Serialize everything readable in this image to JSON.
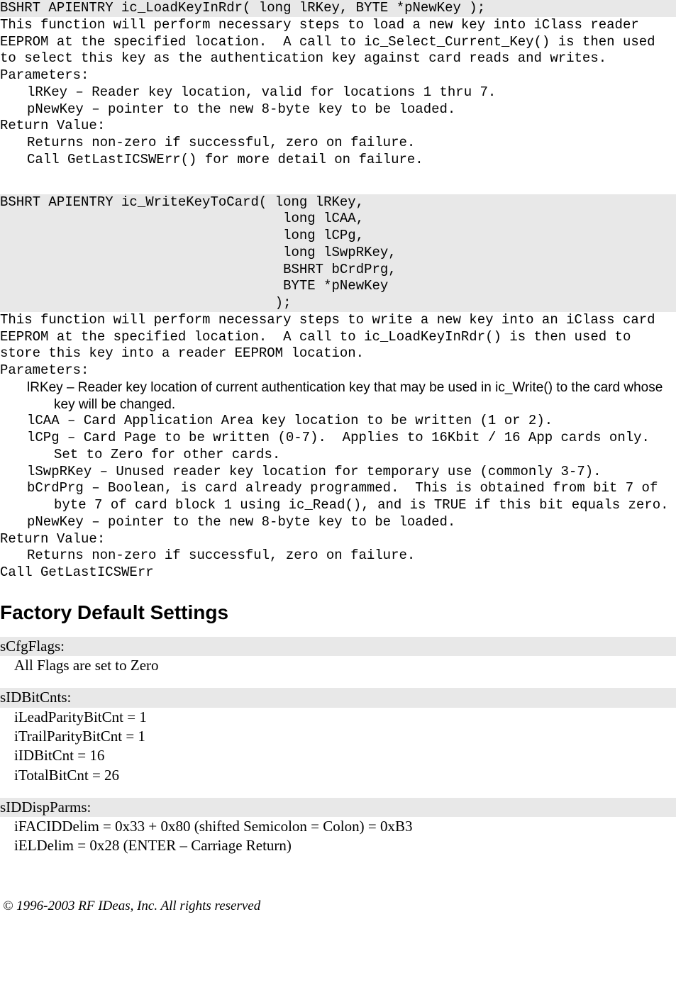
{
  "func1": {
    "sig": "BSHRT APIENTRY ic_LoadKeyInRdr( long lRKey, BYTE *pNewKey );",
    "desc": "This function will perform necessary steps to load a new key into iClass reader EEPROM at the specified location.  A call to ic_Select_Current_Key() is then used to select this key as the authentication key against card reads and writes.",
    "params_label": "Parameters:",
    "p1": "lRKey – Reader key location, valid for locations 1 thru 7.",
    "p2": "pNewKey – pointer to the new 8-byte key to be loaded.",
    "ret_label": "Return Value:",
    "r1": "Returns non-zero if successful, zero on failure.",
    "r2": "Call GetLastICSWErr() for more detail on failure."
  },
  "func2": {
    "sig": "BSHRT APIENTRY ic_WriteKeyToCard( long lRKey,\n                                   long lCAA,\n                                   long lCPg,\n                                   long lSwpRKey,\n                                   BSHRT bCrdPrg,\n                                   BYTE *pNewKey\n                                  );",
    "desc": "This function will perform necessary steps to write a new key into an iClass card EEPROM at the specified location.  A call to ic_LoadKeyInRdr() is then used to store this key into a reader EEPROM location.",
    "params_label": "Parameters:",
    "p1": "lRKey – Reader key location of current authentication key that may be used in ic_Write() to the card whose key will be changed.",
    "p2": "lCAA – Card Application Area key location to be written (1 or 2).",
    "p3": "lCPg – Card Page to be written (0-7).  Applies to 16Kbit / 16 App cards only.  Set to Zero for other cards.",
    "p4": "lSwpRKey – Unused reader key location for temporary use (commonly 3-7).",
    "p5": "bCrdPrg – Boolean, is card already programmed.  This is obtained from bit 7 of byte 7 of card block 1 using ic_Read(), and is TRUE if this bit equals zero.",
    "p6": "pNewKey – pointer to the new 8-byte key to be loaded.",
    "ret_label": "Return Value:",
    "r1": "Returns non-zero if successful, zero on failure.",
    "tail": "Call GetLastICSWErr"
  },
  "factory": {
    "heading": "Factory Default Settings",
    "s1_label": "sCfgFlags:",
    "s1_v1": "All Flags are set to Zero",
    "s2_label": "sIDBitCnts:",
    "s2_v1": "iLeadParityBitCnt = 1",
    "s2_v2": "iTrailParityBitCnt = 1",
    "s2_v3": "iIDBitCnt = 16",
    "s2_v4": "iTotalBitCnt = 26",
    "s3_label": "sIDDispParms:",
    "s3_v1": "iFACIDDelim = 0x33 + 0x80 (shifted Semicolon = Colon) = 0xB3",
    "s3_v2": "iELDelim = 0x28 (ENTER – Carriage Return)"
  },
  "footer": "© 1996-2003 RF IDeas, Inc. All rights reserved"
}
